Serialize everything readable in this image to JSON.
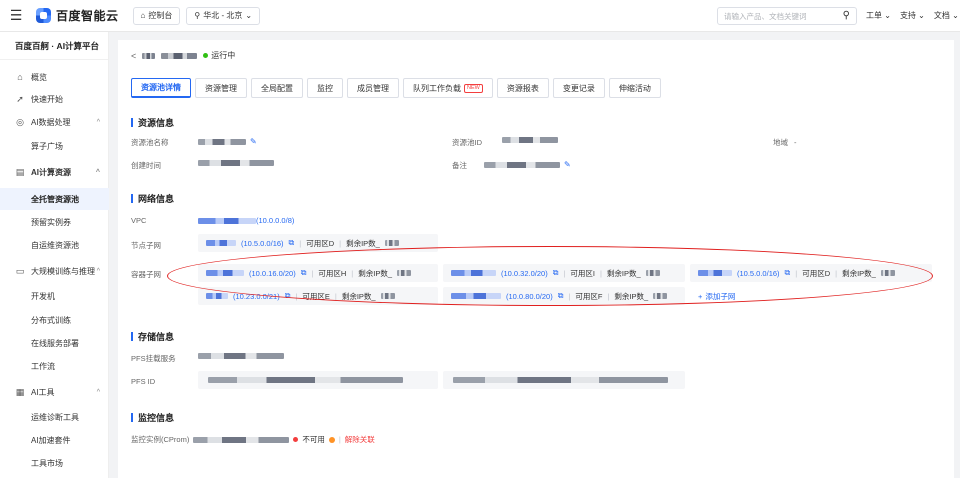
{
  "topbar": {
    "menu_icon": "menu-icon",
    "brand": "百度智能云",
    "console_btn": "控制台",
    "region_btn": "华北 - 北京",
    "search_placeholder": "请输入产品、文档关键词",
    "links": [
      "工单",
      "支持",
      "文档"
    ]
  },
  "sidebar": {
    "title": "百度百舸 · AI计算平台",
    "items": [
      {
        "label": "概览",
        "icon": "home-icon"
      },
      {
        "label": "快速开始",
        "icon": "rocket-icon"
      },
      {
        "label": "AI数据处理",
        "icon": "data-icon"
      },
      {
        "label": "算子广场"
      },
      {
        "label": "AI计算资源",
        "icon": "server-icon"
      },
      {
        "label": "全托管资源池"
      },
      {
        "label": "预留实例券"
      },
      {
        "label": "自运维资源池"
      },
      {
        "label": "大规模训练与推理",
        "icon": "monitor-icon"
      },
      {
        "label": "开发机"
      },
      {
        "label": "分布式训练"
      },
      {
        "label": "在线服务部署"
      },
      {
        "label": "工作流"
      },
      {
        "label": "AI工具",
        "icon": "grid-icon"
      },
      {
        "label": "运维诊断工具"
      },
      {
        "label": "AI加速套件"
      },
      {
        "label": "工具市场"
      }
    ]
  },
  "header": {
    "status": "运行中",
    "status_color": "#30bf13"
  },
  "tabs": [
    "资源池详情",
    "资源管理",
    "全局配置",
    "监控",
    "成员管理",
    "队列工作负载",
    "资源报表",
    "变更记录",
    "伸缩活动"
  ],
  "tab_new_badge": "NEW",
  "resource_info": {
    "title": "资源信息",
    "pool_name_label": "资源池名称",
    "pool_id_label": "资源池ID",
    "region_label": "地域",
    "region_value": "-",
    "created_label": "创建时间",
    "remark_label": "备注"
  },
  "network_info": {
    "title": "网络信息",
    "vpc_label": "VPC",
    "vpc_cidr": "(10.0.0.0/8)",
    "node_subnet_label": "节点子网",
    "node_subnet": {
      "cidr": "(10.5.0.0/16)",
      "zone": "可用区D",
      "remain": "剩余IP数_"
    },
    "container_subnet_label": "容器子网",
    "container_subnets": [
      {
        "cidr": "(10.0.16.0/20)",
        "zone": "可用区H",
        "remain": "剩余IP数_"
      },
      {
        "cidr": "(10.0.32.0/20)",
        "zone": "可用区I",
        "remain": "剩余IP数_"
      },
      {
        "cidr": "(10.5.0.0/16)",
        "zone": "可用区D",
        "remain": "剩余IP数_"
      },
      {
        "cidr": "(10.23.0.0/21)",
        "zone": "可用区E",
        "remain": "剩余IP数_"
      },
      {
        "cidr": "(10.0.80.0/20)",
        "zone": "可用区F",
        "remain": "剩余IP数_"
      }
    ],
    "add_subnet": "添加子网"
  },
  "storage_info": {
    "title": "存储信息",
    "pfs_service_label": "PFS挂载服务",
    "pfs_id_label": "PFS ID"
  },
  "monitor_info": {
    "title": "监控信息",
    "instance_label": "监控实例(CProm)",
    "unavailable": "不可用",
    "unbind": "解除关联"
  }
}
